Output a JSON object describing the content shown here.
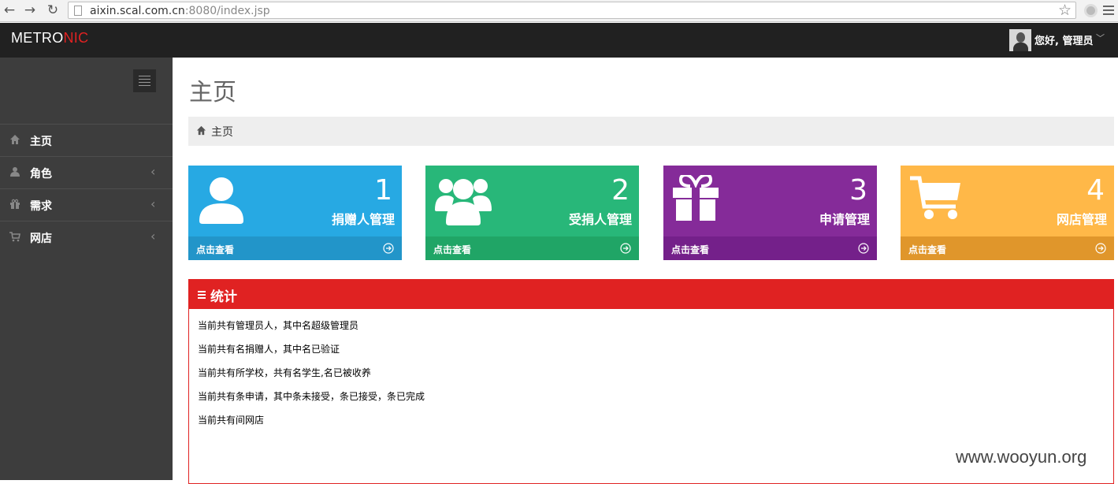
{
  "browser": {
    "back_glyph": "←",
    "forward_glyph": "→",
    "reload_glyph": "↻",
    "url_host": "aixin.scal.com.cn",
    "url_rest": ":8080/index.jsp",
    "star_glyph": "☆"
  },
  "header": {
    "logo_main": "METRO",
    "logo_accent": "NIC",
    "user_greeting": "您好, 管理员",
    "caret": "﹀"
  },
  "sidebar": {
    "items": [
      {
        "label": "主页",
        "icon": "home-icon",
        "has_chevron": false
      },
      {
        "label": "角色",
        "icon": "user-icon",
        "has_chevron": true
      },
      {
        "label": "需求",
        "icon": "gift-icon",
        "has_chevron": true
      },
      {
        "label": "网店",
        "icon": "cart-icon",
        "has_chevron": true
      }
    ],
    "chevron_glyph": "‹"
  },
  "main": {
    "page_title": "主页",
    "breadcrumb": "主页",
    "tiles": [
      {
        "number": "1",
        "title": "捐赠人管理",
        "more": "点击查看",
        "icon": "user-icon",
        "color": "#27a9e3",
        "footer_color": "#2295c9"
      },
      {
        "number": "2",
        "title": "受捐人管理",
        "more": "点击查看",
        "icon": "group-icon",
        "color": "#28b779",
        "footer_color": "#20a566"
      },
      {
        "number": "3",
        "title": "申请管理",
        "more": "点击查看",
        "icon": "gift-icon",
        "color": "#852b99",
        "footer_color": "#74208a"
      },
      {
        "number": "4",
        "title": "网店管理",
        "more": "点击查看",
        "icon": "cart-icon",
        "color": "#ffb848",
        "footer_color": "#e0962b"
      }
    ],
    "stats": {
      "title": "统计",
      "accent_color": "#e02222",
      "lines": [
        "当前共有管理员人，其中名超级管理员",
        "当前共有名捐赠人，其中名已验证",
        "当前共有所学校，共有名学生,名已被收养",
        "当前共有条申请，其中条未接受，条已接受，条已完成",
        "当前共有间网店"
      ]
    }
  },
  "watermark": "www.wooyun.org"
}
